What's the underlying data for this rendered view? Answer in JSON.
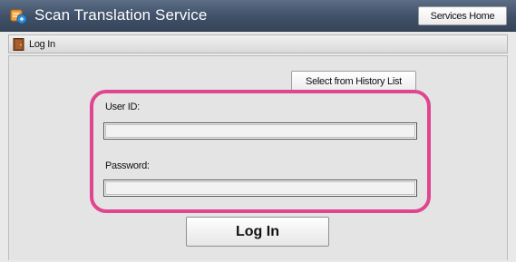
{
  "window": {
    "title": "Scan Translation Service",
    "icon": "scan-translation-icon"
  },
  "header": {
    "services_home_label": "Services Home"
  },
  "subheader": {
    "title": "Log In",
    "icon": "door-icon"
  },
  "form": {
    "history_button_label": "Select from History List",
    "user_id_label": "User ID:",
    "user_id_value": "",
    "password_label": "Password:",
    "password_value": "",
    "login_button_label": "Log In"
  },
  "colors": {
    "title_bar": "#3f5068",
    "highlight_border": "#e0468f",
    "panel_background": "#e4e4e4"
  }
}
